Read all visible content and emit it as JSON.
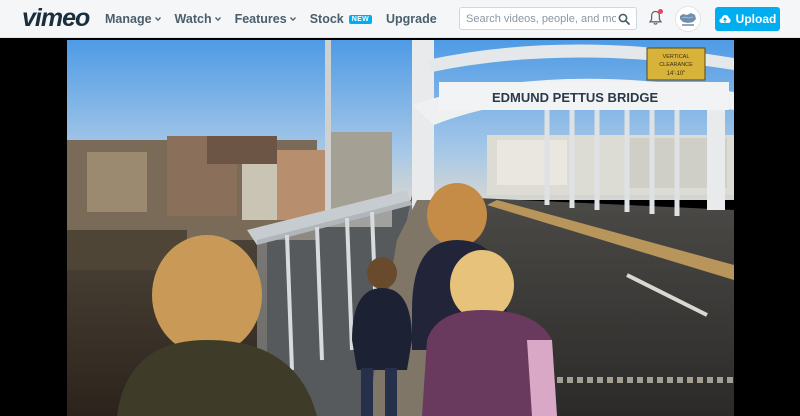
{
  "header": {
    "logo": "vimeo",
    "nav": [
      {
        "label": "Manage",
        "dropdown": true
      },
      {
        "label": "Watch",
        "dropdown": true
      },
      {
        "label": "Features",
        "dropdown": true
      },
      {
        "label": "Stock",
        "badge": "NEW"
      },
      {
        "label": "Upgrade"
      }
    ],
    "search": {
      "placeholder": "Search videos, people, and more"
    },
    "upload_label": "Upload",
    "notification_icon": "bell-icon",
    "accent_color": "#00adef"
  },
  "video": {
    "sign_text": "EDMUND PETTUS BRIDGE",
    "clearance_sign": [
      "VERTICAL",
      "CLEARANCE",
      "14'-10\""
    ]
  }
}
